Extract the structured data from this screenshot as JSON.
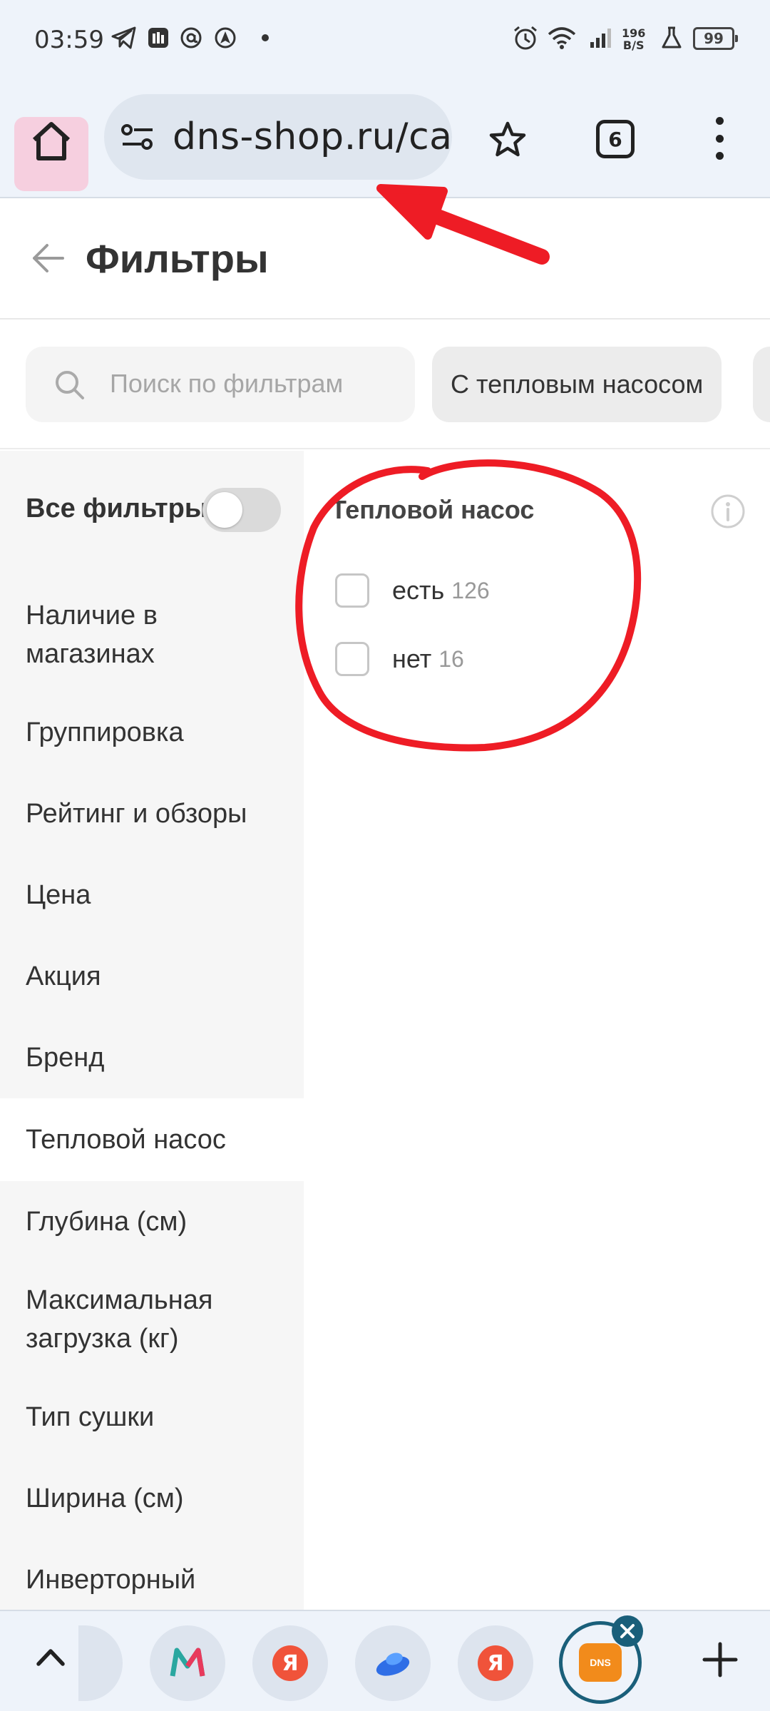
{
  "status_bar": {
    "time": "03:59",
    "net_speed_value": "196",
    "net_speed_unit": "B/S",
    "battery": "99",
    "icons": [
      "telegram-icon",
      "mail-app-icon",
      "at-icon",
      "navigation-icon",
      "dot-icon",
      "alarm-icon",
      "wifi-icon",
      "signal-icon",
      "lab-flask-icon"
    ]
  },
  "browser": {
    "url": "dns-shop.ru/catalog",
    "tab_count": "6"
  },
  "page": {
    "title": "Фильтры"
  },
  "search": {
    "placeholder": "Поиск по фильтрам"
  },
  "chips": [
    {
      "label": "С тепловым насосом"
    }
  ],
  "sidebar": {
    "all_filters_label": "Все фильтры",
    "items": [
      {
        "label": "Наличие в магазинах"
      },
      {
        "label": "Группировка"
      },
      {
        "label": "Рейтинг и обзоры"
      },
      {
        "label": "Цена"
      },
      {
        "label": "Акция"
      },
      {
        "label": "Бренд"
      },
      {
        "label": "Тепловой насос",
        "active": true
      },
      {
        "label": "Глубина (см)"
      },
      {
        "label": "Максимальная загрузка (кг)"
      },
      {
        "label": "Тип сушки"
      },
      {
        "label": "Ширина (см)"
      },
      {
        "label": "Инверторный"
      }
    ]
  },
  "filter_panel": {
    "title": "Тепловой насос",
    "options": [
      {
        "label": "есть",
        "count": "126"
      },
      {
        "label": "нет",
        "count": "16"
      }
    ]
  },
  "tab_strip": {
    "dns_logo_text": "DNS",
    "ya_glyph": "Я"
  },
  "colors": {
    "annotation_red": "#ee1c25",
    "browser_bg": "#eef3fa",
    "dns_orange": "#f28b1b",
    "active_tab_ring": "#1a5f7a"
  }
}
